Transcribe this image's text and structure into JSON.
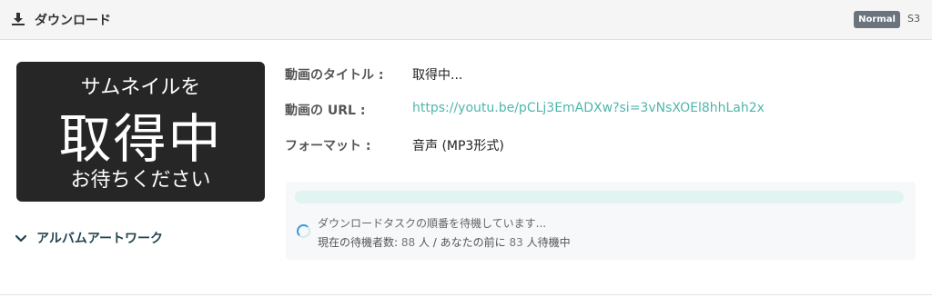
{
  "header": {
    "icon": "download-icon",
    "title": "ダウンロード",
    "badge": "Normal",
    "badge_suffix": "S3"
  },
  "thumbnail": {
    "line1": "サムネイルを",
    "line2": "取得中",
    "line3": "お待ちください"
  },
  "info": {
    "title_label": "動画のタイトル :",
    "title_value": "取得中...",
    "url_label": "動画の URL :",
    "url_value": "https://youtu.be/pCLj3EmADXw?si=3vNsXOEl8hhLah2x",
    "format_label": "フォーマット :",
    "format_value": "音声 (MP3形式)"
  },
  "status": {
    "progress": 0,
    "message": "ダウンロードタスクの順番を待機しています...",
    "waiting_label": "現在の待機者数:",
    "waiting_count": "88",
    "waiting_unit": "人 / あなたの前に",
    "ahead_count": "83",
    "ahead_unit": "人待機中"
  },
  "artwork": {
    "label": "アルバムアートワーク",
    "icon": "chevron-down-icon"
  },
  "colors": {
    "accent": "#4fb6ab",
    "progress_track": "#e2f4f1",
    "badge": "#6b747c"
  }
}
